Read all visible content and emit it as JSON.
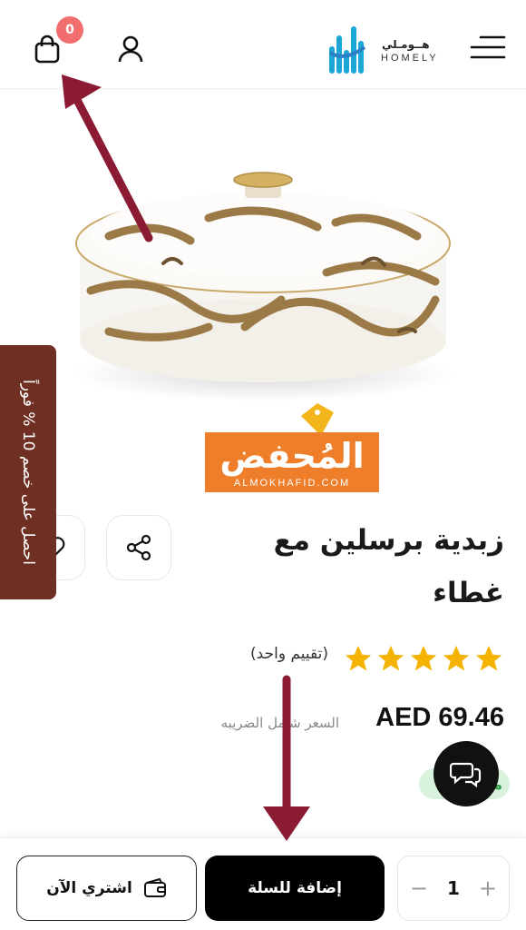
{
  "header": {
    "cart_badge": "0",
    "logo_arabic": "هــومـلي",
    "logo_english": "HOMELY"
  },
  "watermark": {
    "title": "المُحفض",
    "subtitle": "ALMOKHAFID.COM"
  },
  "promo": {
    "side_tab": "احصل على خصم 10 % فوراً"
  },
  "product": {
    "title": "زبدية برسلين مع غطاء",
    "rating_stars": 5,
    "rating_text": "(تقييم واحد)",
    "price": "AED 69.46",
    "tax_note": "السعر شامل الضريبه",
    "stock_badge": "متوفر"
  },
  "actions": {
    "buy_now": "اشتري الآن",
    "add_to_cart": "إضافة للسلة",
    "quantity": "1",
    "minus": "−",
    "plus": "+"
  },
  "colors": {
    "accent_dark": "#000000",
    "promo_tab": "#6f2f22",
    "badge": "#f26d6d",
    "star": "#f5b301",
    "arrow": "#8b1a33"
  }
}
